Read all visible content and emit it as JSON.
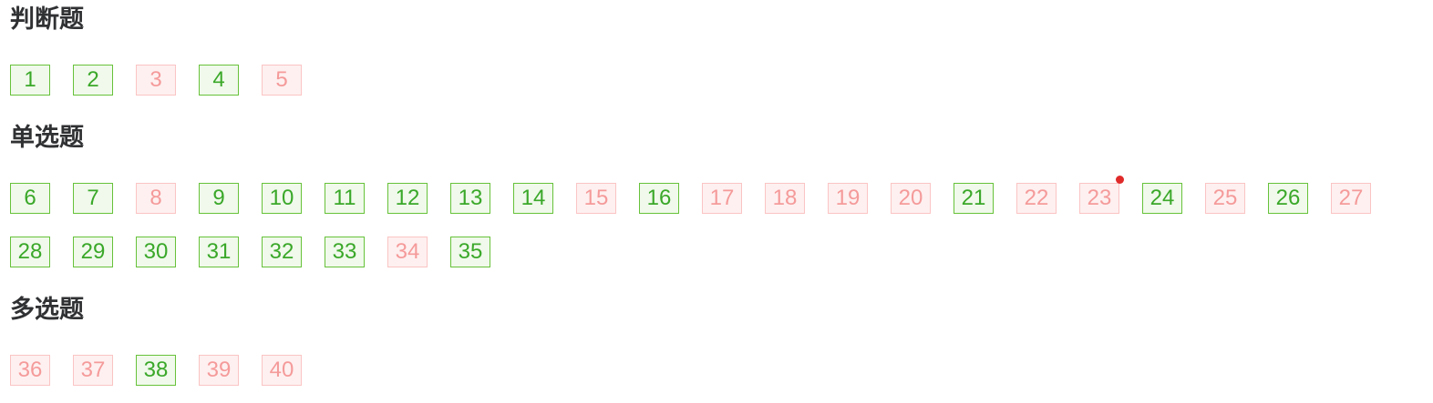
{
  "sections": [
    {
      "title": "判断题",
      "rows": [
        [
          {
            "label": "1",
            "status": "correct"
          },
          {
            "label": "2",
            "status": "correct"
          },
          {
            "label": "3",
            "status": "wrong"
          },
          {
            "label": "4",
            "status": "correct"
          },
          {
            "label": "5",
            "status": "wrong"
          }
        ]
      ]
    },
    {
      "title": "单选题",
      "rows": [
        [
          {
            "label": "6",
            "status": "correct"
          },
          {
            "label": "7",
            "status": "correct"
          },
          {
            "label": "8",
            "status": "wrong"
          },
          {
            "label": "9",
            "status": "correct"
          },
          {
            "label": "10",
            "status": "correct"
          },
          {
            "label": "11",
            "status": "correct"
          },
          {
            "label": "12",
            "status": "correct"
          },
          {
            "label": "13",
            "status": "correct"
          },
          {
            "label": "14",
            "status": "correct"
          },
          {
            "label": "15",
            "status": "wrong"
          },
          {
            "label": "16",
            "status": "correct"
          },
          {
            "label": "17",
            "status": "wrong"
          },
          {
            "label": "18",
            "status": "wrong"
          },
          {
            "label": "19",
            "status": "wrong"
          },
          {
            "label": "20",
            "status": "wrong"
          },
          {
            "label": "21",
            "status": "correct"
          },
          {
            "label": "22",
            "status": "wrong"
          },
          {
            "label": "23",
            "status": "wrong",
            "marked": true
          },
          {
            "label": "24",
            "status": "correct"
          },
          {
            "label": "25",
            "status": "wrong"
          },
          {
            "label": "26",
            "status": "correct"
          },
          {
            "label": "27",
            "status": "wrong"
          }
        ],
        [
          {
            "label": "28",
            "status": "correct"
          },
          {
            "label": "29",
            "status": "correct"
          },
          {
            "label": "30",
            "status": "correct"
          },
          {
            "label": "31",
            "status": "correct"
          },
          {
            "label": "32",
            "status": "correct"
          },
          {
            "label": "33",
            "status": "correct"
          },
          {
            "label": "34",
            "status": "wrong"
          },
          {
            "label": "35",
            "status": "correct"
          }
        ]
      ]
    },
    {
      "title": "多选题",
      "rows": [
        [
          {
            "label": "36",
            "status": "wrong"
          },
          {
            "label": "37",
            "status": "wrong"
          },
          {
            "label": "38",
            "status": "correct"
          },
          {
            "label": "39",
            "status": "wrong"
          },
          {
            "label": "40",
            "status": "wrong"
          }
        ]
      ]
    }
  ],
  "colors": {
    "correct_bg": "#f0f9eb",
    "correct_border": "#67c23a",
    "correct_text": "#3aa829",
    "wrong_bg": "#fef0f0",
    "wrong_border": "#fbc4c4",
    "wrong_text": "#f59a9a",
    "marker_dot": "#e02a2a",
    "title_text": "#303133"
  }
}
